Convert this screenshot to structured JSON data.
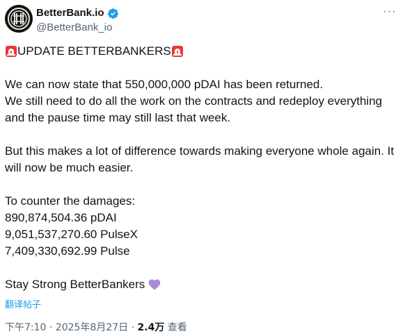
{
  "author": {
    "display_name": "BetterBank.io",
    "handle": "@BetterBank_io",
    "verified_color": "#1d9bf0",
    "avatar_icon": "betterbank-logo-icon"
  },
  "more_button": {
    "icon": "more-horizontal-icon",
    "label": "···"
  },
  "tweet": {
    "headline_text": "UPDATE BETTERBANKERS",
    "headline_icon": "rotating-light-siren-icon",
    "paragraph1_line1": "We can now state that 550,000,000 pDAI has been returned.",
    "paragraph1_rest": "We still need to do all the work on the contracts and redeploy everything and the pause time may still last that week.",
    "paragraph2": "But this makes a lot of difference towards making everyone whole again. It will now be much easier.",
    "counter_heading": "To counter the damages:",
    "amounts": [
      "890,874,504.36 pDAI",
      "9,051,537,270.60 PulseX",
      "7,409,330,692.99 Pulse"
    ],
    "closing_text": "Stay Strong BetterBankers",
    "closing_icon": "purple-heart-icon",
    "heart_color": "#a98bdc"
  },
  "translate_link": "翻译帖子",
  "meta": {
    "time": "下午7:10",
    "separator": "·",
    "date": "2025年8月27日",
    "views_count": "2.4万",
    "views_label": "查看"
  }
}
